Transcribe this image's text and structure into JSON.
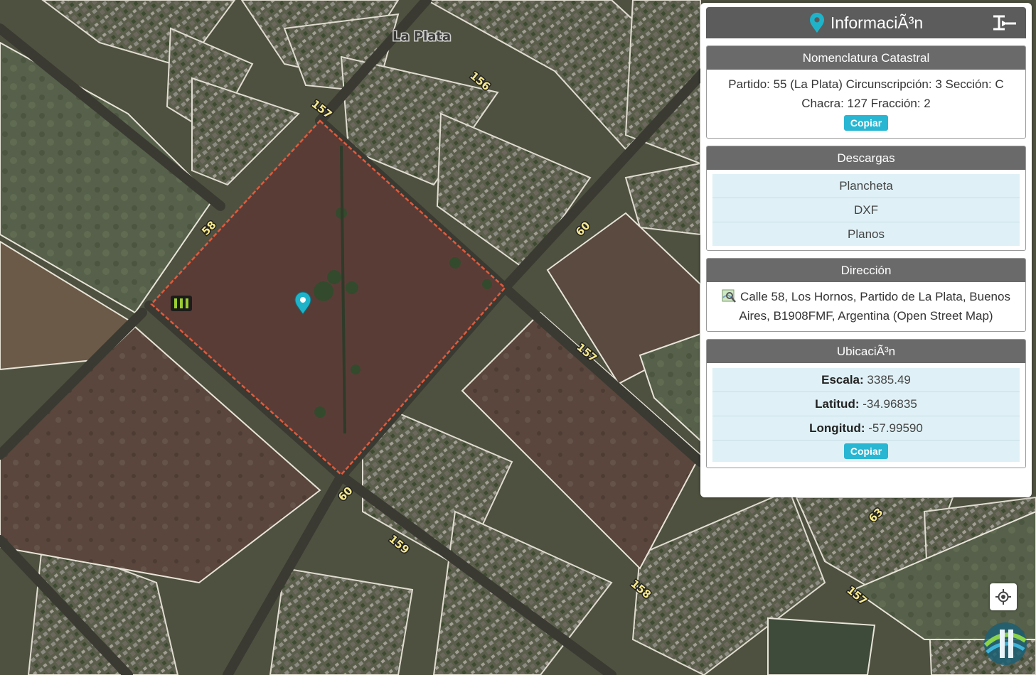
{
  "map": {
    "city_label": "La Plata",
    "road_labels": [
      "157",
      "156",
      "58",
      "60",
      "157",
      "60",
      "159",
      "158",
      "63",
      "157"
    ],
    "marker_icon": "map-pin-icon",
    "parcel_color": "#e05a3c"
  },
  "panel": {
    "title": "InformaciÃ³n",
    "title_icon": "map-pin-icon",
    "collapse_icon": "collapse-icon",
    "accent": "#29b6d2",
    "nomenclatura": {
      "heading": "Nomenclatura Catastral",
      "text": "Partido: 55 (La Plata) Circunscripción: 3 Sección: C Chacra: 127 Fracción: 2",
      "copy_label": "Copiar"
    },
    "descargas": {
      "heading": "Descargas",
      "items": [
        "Plancheta",
        "DXF",
        "Planos"
      ]
    },
    "direccion": {
      "heading": "Dirección",
      "icon": "map-search-icon",
      "text": "Calle 58, Los Hornos, Partido de La Plata, Buenos Aires, B1908FMF, Argentina (Open Street Map)"
    },
    "ubicacion": {
      "heading": "UbicaciÃ³n",
      "escala_label": "Escala:",
      "escala_value": "3385.49",
      "latitud_label": "Latitud:",
      "latitud_value": "-34.96835",
      "longitud_label": "Longitud:",
      "longitud_value": "-57.99590",
      "copy_label": "Copiar"
    }
  },
  "controls": {
    "locate_icon": "locate-crosshair-icon",
    "logo_icon": "agency-logo-icon"
  }
}
